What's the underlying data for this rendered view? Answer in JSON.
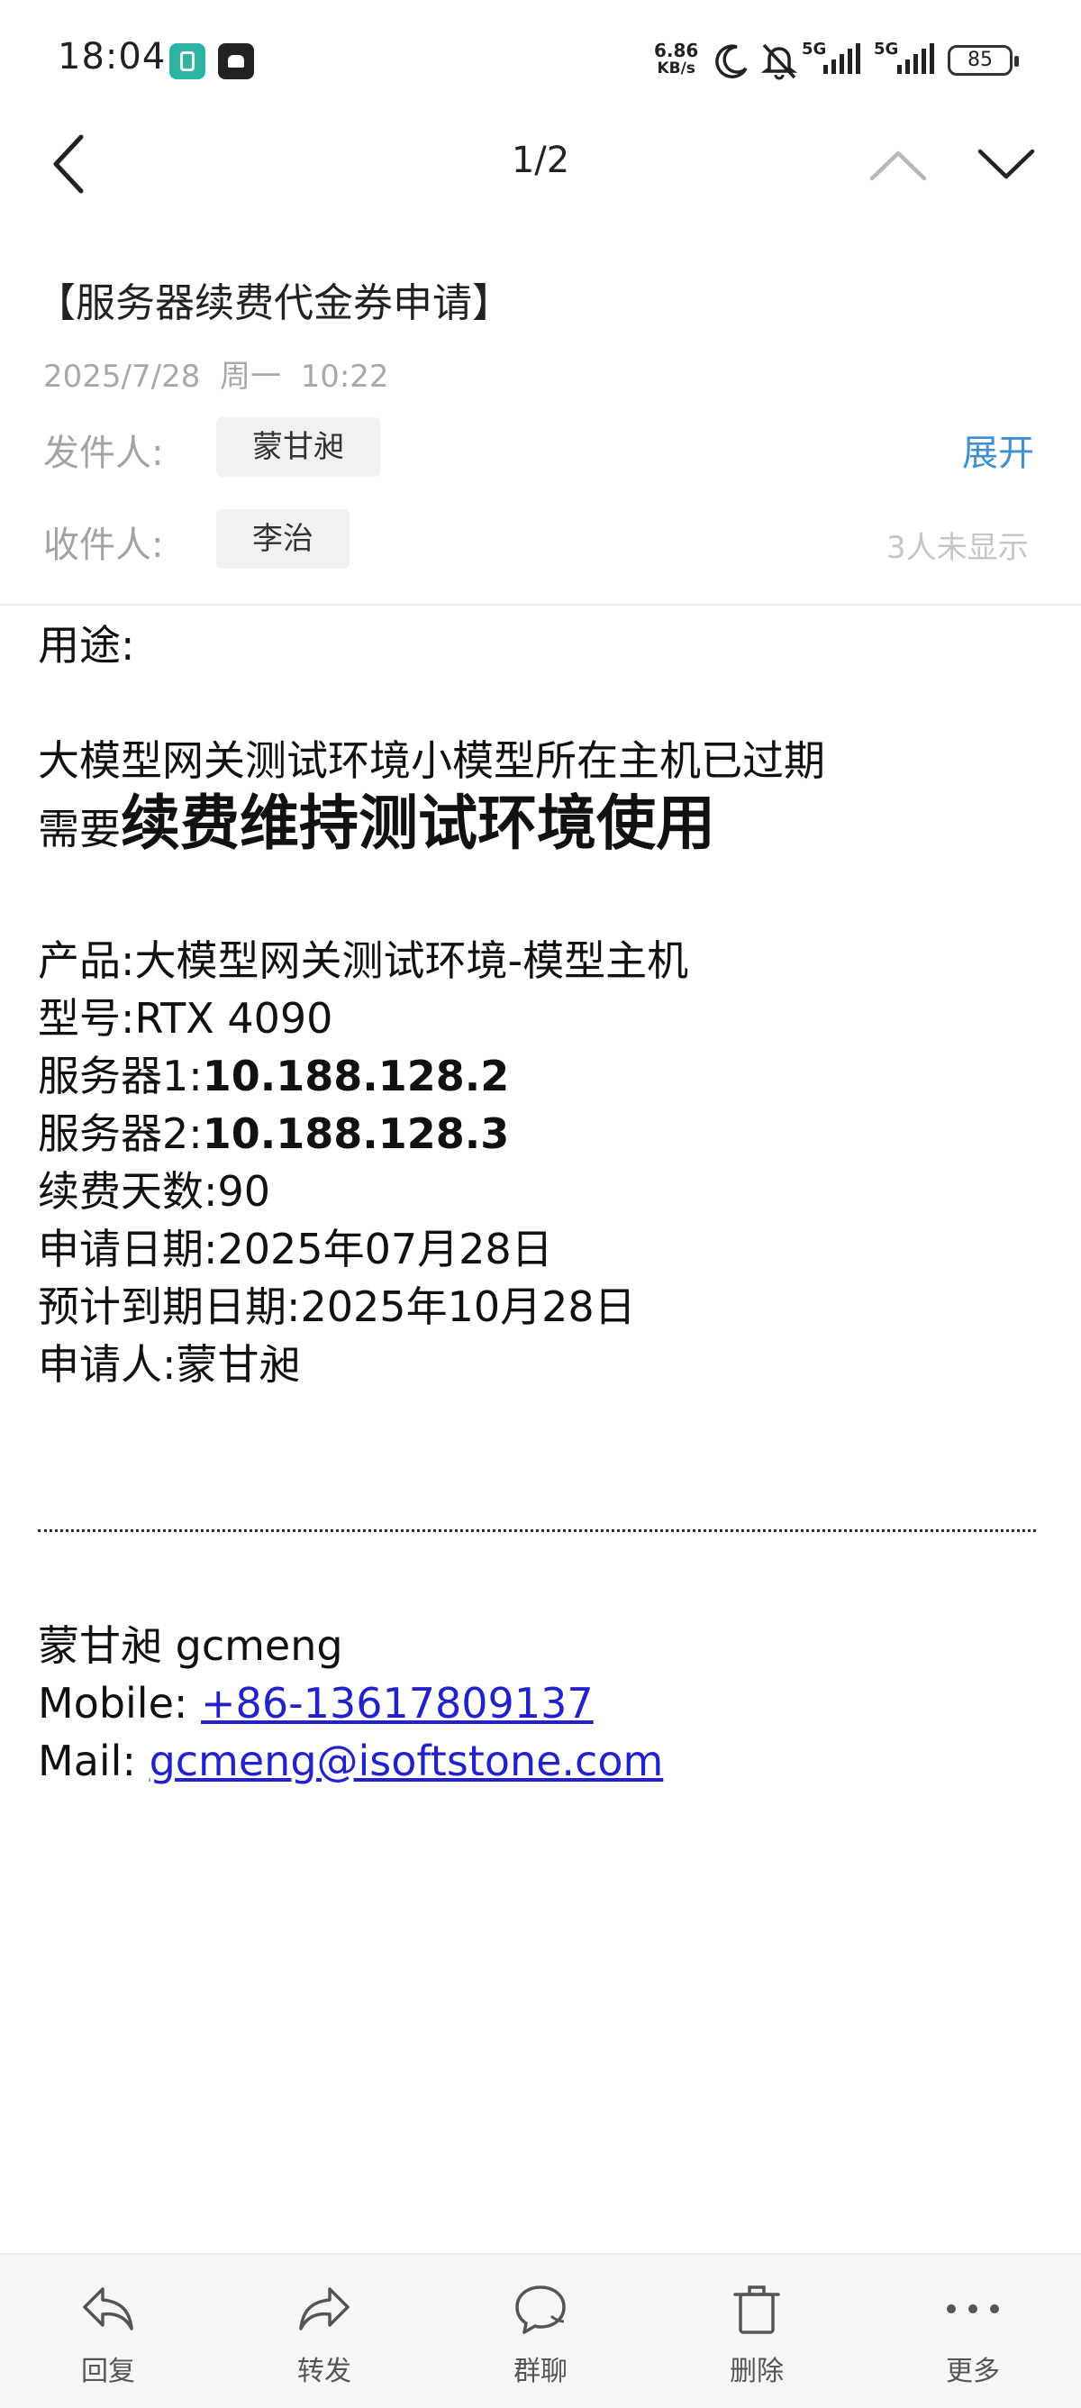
{
  "status_bar": {
    "time": "18:04",
    "net_speed_value": "6.86",
    "net_speed_unit": "KB/s",
    "sim1": "5G",
    "sim2": "5G",
    "battery": "85"
  },
  "nav": {
    "pager": "1/2"
  },
  "mail": {
    "subject": "【服务器续费代金券申请】",
    "datetime": "2025/7/28  周一  10:22",
    "sender_label": "发件人:",
    "sender": "蒙甘昶",
    "expand": "展开",
    "recipient_label": "收件人:",
    "recipient": "李治",
    "hidden_count": "3人未显示"
  },
  "body": {
    "purpose_label": "用途:",
    "line1": "大模型网关测试环境小模型所在主机已过期",
    "line2_prefix": "需要",
    "line2_bold": "续费维持测试环境使用",
    "product": "产品:大模型网关测试环境-模型主机",
    "model": "型号:RTX 4090",
    "server1_label": "服务器1:",
    "server1_ip": "10.188.128.2",
    "server2_label": "服务器2:",
    "server2_ip": "10.188.128.3",
    "days": "续费天数:90",
    "apply_date": "申请日期:2025年07月28日",
    "expire_date": "预计到期日期:2025年10月28日",
    "applicant": "申请人:蒙甘昶"
  },
  "signature": {
    "name": "蒙甘昶 gcmeng",
    "mobile_label": "Mobile: ",
    "mobile": "+86-13617809137",
    "mail_label": "Mail: ",
    "mail": "gcmeng@isoftstone.com"
  },
  "bottom_bar": {
    "reply": "回复",
    "forward": "转发",
    "group_chat": "群聊",
    "delete": "删除",
    "more": "更多"
  },
  "colors": {
    "link": "#2222cc",
    "accent": "#3f90d3",
    "muted": "#a8a8a8"
  }
}
